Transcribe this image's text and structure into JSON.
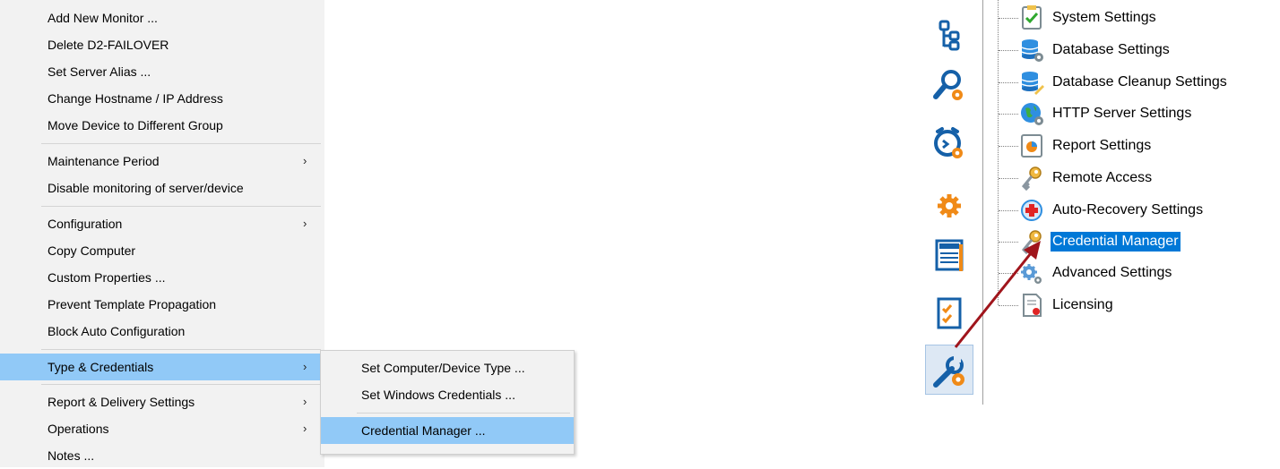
{
  "context_menu": {
    "items": [
      {
        "label": "Add New Monitor ..."
      },
      {
        "label": "Delete D2-FAILOVER"
      },
      {
        "label": "Set Server Alias ..."
      },
      {
        "label": "Change Hostname / IP Address"
      },
      {
        "label": "Move Device to Different Group"
      },
      {
        "label": "Maintenance Period",
        "arrow": "›"
      },
      {
        "label": "Disable monitoring of server/device"
      },
      {
        "label": "Configuration",
        "arrow": "›"
      },
      {
        "label": "Copy Computer"
      },
      {
        "label": "Custom Properties ..."
      },
      {
        "label": "Prevent Template Propagation"
      },
      {
        "label": "Block Auto Configuration"
      },
      {
        "label": "Type & Credentials",
        "arrow": "›"
      },
      {
        "label": "Report & Delivery Settings",
        "arrow": "›"
      },
      {
        "label": "Operations",
        "arrow": "›"
      },
      {
        "label": "Notes ..."
      }
    ]
  },
  "submenu": {
    "items": [
      {
        "label": "Set Computer/Device Type ..."
      },
      {
        "label": "Set Windows Credentials ..."
      },
      {
        "label": "Credential Manager ..."
      }
    ]
  },
  "toolbar": {
    "buttons": [
      {
        "icon": "tree-structure-icon"
      },
      {
        "icon": "search-gear-icon"
      },
      {
        "icon": "alarm-clock-gear-icon"
      },
      {
        "icon": "gear-icon"
      },
      {
        "icon": "news-report-icon"
      },
      {
        "icon": "checklist-icon"
      },
      {
        "icon": "wrench-gear-icon"
      }
    ]
  },
  "settings_tree": {
    "items": [
      {
        "label": "System Settings",
        "icon": "checklist-icon"
      },
      {
        "label": "Database Settings",
        "icon": "database-gear-icon"
      },
      {
        "label": "Database Cleanup Settings",
        "icon": "database-broom-icon"
      },
      {
        "label": "HTTP Server Settings",
        "icon": "globe-gear-icon"
      },
      {
        "label": "Report Settings",
        "icon": "report-chart-icon"
      },
      {
        "label": "Remote Access",
        "icon": "key-icon"
      },
      {
        "label": "Auto-Recovery Settings",
        "icon": "medical-cross-icon"
      },
      {
        "label": "Credential Manager",
        "icon": "key-icon"
      },
      {
        "label": "Advanced Settings",
        "icon": "gears-icon"
      },
      {
        "label": "Licensing",
        "icon": "certificate-icon"
      }
    ]
  },
  "colors": {
    "menu_bg": "#f2f2f2",
    "menu_highlight": "#91c9f7",
    "tree_selection": "#0078d7",
    "annotation_arrow": "#a0151c",
    "icon_orange": "#f08a17",
    "icon_blue": "#1560a8"
  }
}
